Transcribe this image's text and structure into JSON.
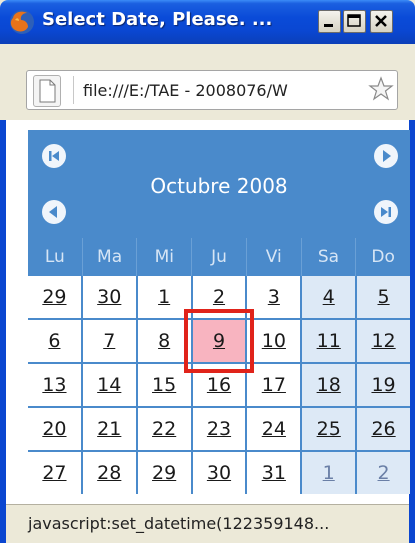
{
  "window": {
    "title": "Select Date, Please. ...",
    "min_label": "_",
    "max_label": "□",
    "close_label": "X"
  },
  "address_bar": {
    "url": "file:///E:/TAE - 2008076/W"
  },
  "calendar": {
    "month_title": "Octubre 2008",
    "weekdays": [
      "Lu",
      "Ma",
      "Mi",
      "Ju",
      "Vi",
      "Sa",
      "Do"
    ],
    "weeks": [
      [
        "29",
        "30",
        "1",
        "2",
        "3",
        "4",
        "5"
      ],
      [
        "6",
        "7",
        "8",
        "9",
        "10",
        "11",
        "12"
      ],
      [
        "13",
        "14",
        "15",
        "16",
        "17",
        "18",
        "19"
      ],
      [
        "20",
        "21",
        "22",
        "23",
        "24",
        "25",
        "26"
      ],
      [
        "27",
        "28",
        "29",
        "30",
        "31",
        "1",
        "2"
      ]
    ],
    "selected_day": "9",
    "colors": {
      "header": "#4a8acb",
      "weekend": "#dde9f6",
      "today": "#f8b4c0",
      "highlight_ring": "#e0231a"
    }
  },
  "statusbar": {
    "text": "javascript:set_datetime(122359148..."
  }
}
